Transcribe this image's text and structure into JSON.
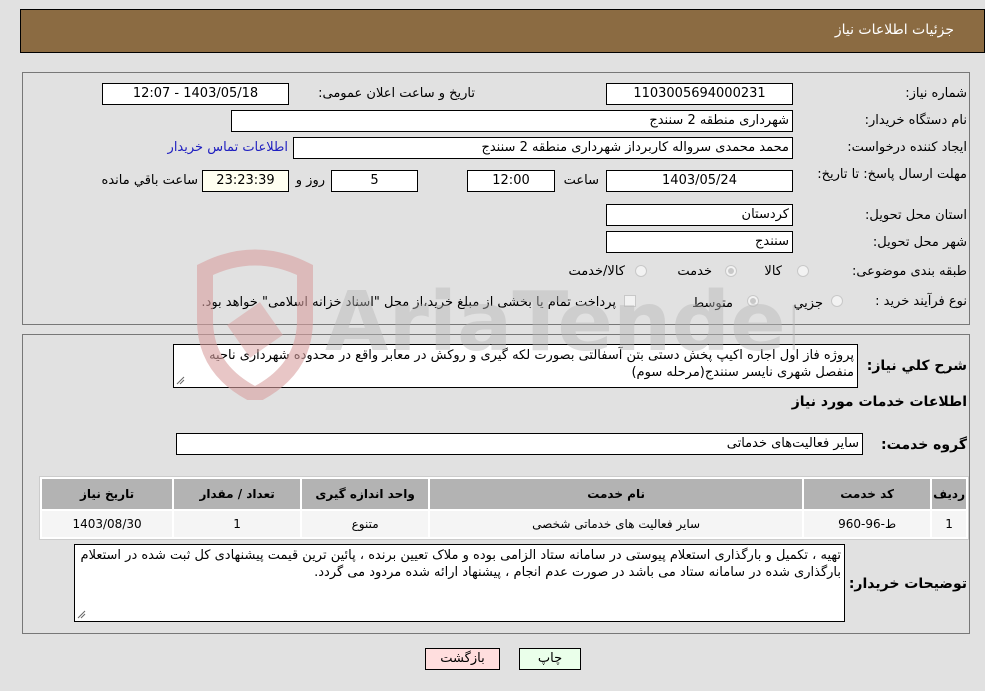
{
  "header": {
    "title": "جزئیات اطلاعات نیاز"
  },
  "form": {
    "need_number_label": "شماره نیاز:",
    "need_number": "1103005694000231",
    "announce_label": "تاریخ و ساعت اعلان عمومی:",
    "announce_value": "1403/05/18 - 12:07",
    "buyer_org_label": "نام دستگاه خریدار:",
    "buyer_org": "شهرداری منطقه 2 سنندج",
    "creator_label": "ایجاد کننده درخواست:",
    "creator": "محمد محمدی سرواله کاربرداز شهرداری منطقه 2 سنندج",
    "contact_link": "اطلاعات تماس خریدار",
    "deadline_label": "مهلت ارسال پاسخ: تا تاریخ:",
    "deadline_date": "1403/05/24",
    "time_label": "ساعت",
    "deadline_time": "12:00",
    "days_value": "5",
    "days_label": "روز و",
    "remaining_time": "23:23:39",
    "remaining_label": "ساعت باقي مانده",
    "province_label": "استان محل تحویل:",
    "province": "کردستان",
    "city_label": "شهر محل تحویل:",
    "city": "سنندج",
    "category_label": "طبقه بندی موضوعی:",
    "category_options": [
      {
        "label": "کالا",
        "selected": false
      },
      {
        "label": "خدمت",
        "selected": true
      },
      {
        "label": "کالا/خدمت",
        "selected": false
      }
    ],
    "process_label": "نوع فرآیند خرید :",
    "process_options": [
      {
        "label": "جزيي",
        "selected": false
      },
      {
        "label": "متوسط",
        "selected": true
      }
    ],
    "treasury_note": "پرداخت تمام یا بخشی از مبلغ خرید،از محل \"اسناد خزانه اسلامی\" خواهد بود."
  },
  "description": {
    "label": "شرح کلي نياز:",
    "text": "پروژه فاز اول اجاره اکیپ پخش دستی بتن آسفالتی بصورت لکه گیری و روکش در معابر واقع در محدوده شهرداری ناحیه منفصل شهری نایسر سنندج(مرحله سوم)"
  },
  "services": {
    "section_title": "اطلاعات خدمات مورد نیاز",
    "group_label": "گروه خدمت:",
    "group_value": "سایر فعالیت‌های خدماتی",
    "columns": [
      "ردیف",
      "کد خدمت",
      "نام خدمت",
      "واحد اندازه گیری",
      "تعداد / مقدار",
      "تاریخ نیاز"
    ],
    "rows": [
      [
        "1",
        "ط-96-960",
        "سایر فعالیت های خدماتی شخصی",
        "متنوع",
        "1",
        "1403/08/30"
      ]
    ]
  },
  "buyer_notes": {
    "label": "توضیحات خریدار:",
    "text": "تهیه ، تکمیل و بارگذاری استعلام پیوستی در سامانه ستاد الزامی بوده و ملاک تعیین برنده ، پائین ترین قیمت پیشنهادی کل ثبت شده در استعلام بارگذاری شده در سامانه ستاد می باشد در صورت عدم انجام ، پیشنهاد ارائه شده مردود می گردد."
  },
  "buttons": {
    "print": "چاپ",
    "back": "بازگشت"
  },
  "watermark": {
    "text": "AriaTender.neT"
  },
  "colors": {
    "header_bg": "#8b6b42",
    "back_btn": "#ffdede",
    "print_btn": "#eaffea",
    "link": "#2020c0"
  }
}
